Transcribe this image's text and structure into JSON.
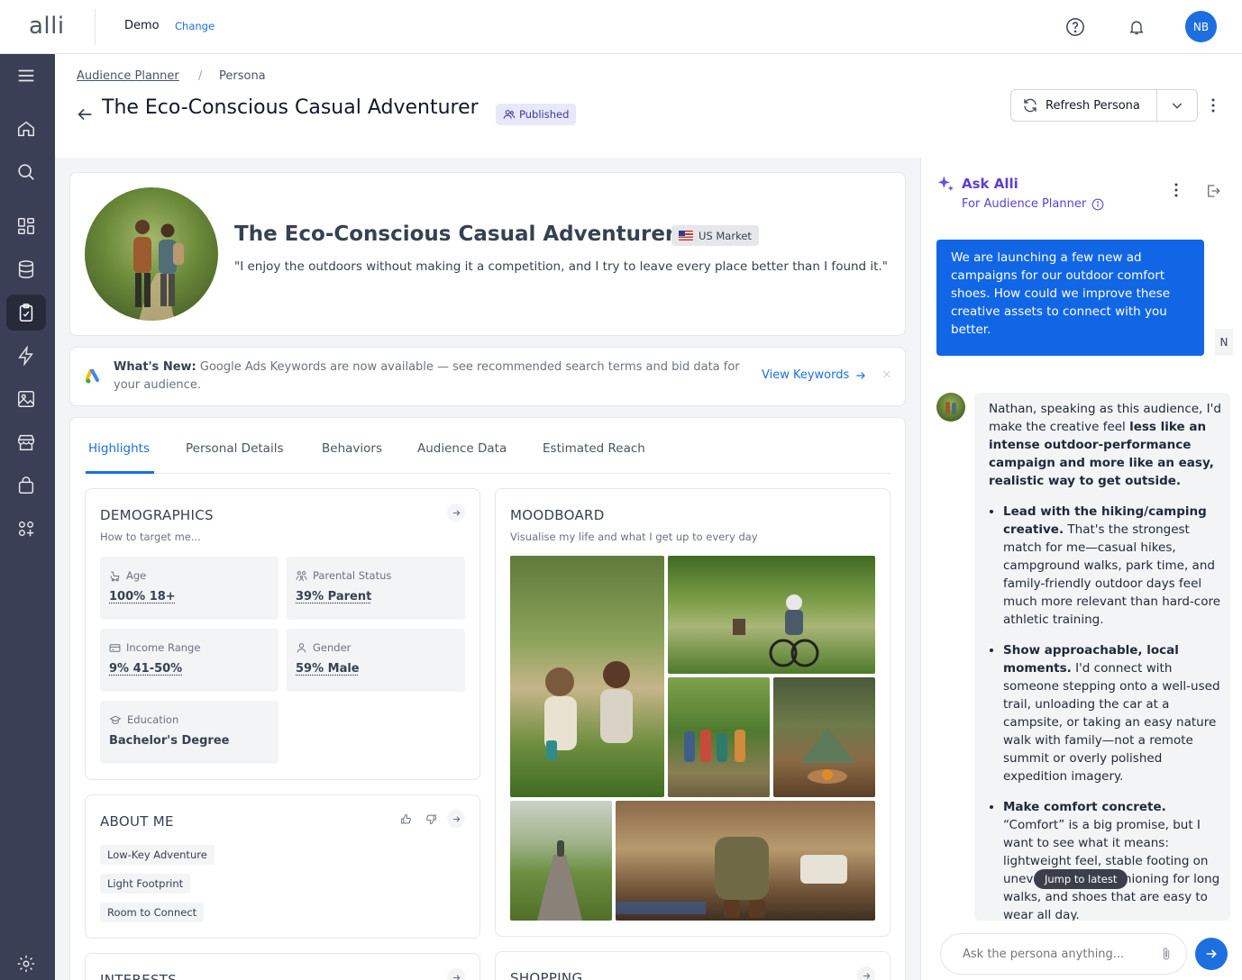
{
  "topbar": {
    "logo": "alli",
    "org_name": "Demo",
    "org_change": "Change",
    "help_icon": "help-circle-icon",
    "bell_icon": "bell-icon",
    "user_initials": "NB",
    "accent": "#1d6fe0"
  },
  "rail": {
    "items": [
      "menu-icon",
      "home-icon",
      "search-icon",
      "dashboard-icon",
      "database-icon",
      "clipboard-check-icon",
      "lightning-icon",
      "image-icon",
      "store-icon",
      "bag-icon",
      "apps-icon",
      "settings-icon"
    ],
    "active": "clipboard-check-icon",
    "bg": "#3a3f55"
  },
  "header": {
    "breadcrumb_link": "Audience Planner",
    "breadcrumb_sep": "/",
    "breadcrumb_current": "Persona",
    "title": "The Eco-Conscious Casual Adventurer",
    "status_badge": "Published",
    "refresh_label": "Refresh Persona"
  },
  "persona": {
    "name": "The Eco-Conscious Casual Adventurer",
    "market": "US Market",
    "quote": "\"I enjoy the outdoors without making it a competition, and I try to leave every place better than I found it.\""
  },
  "news": {
    "label": "What's New:",
    "text": "Google Ads Keywords are now available — see recommended search terms and bid data for your audience.",
    "link": "View Keywords",
    "close": "×"
  },
  "tabs": [
    "Highlights",
    "Personal Details",
    "Behaviors",
    "Audience Data",
    "Estimated Reach"
  ],
  "demographics": {
    "title": "DEMOGRAPHICS",
    "desc": "How to target me...",
    "stats": [
      {
        "label": "Age",
        "value": "100% 18+",
        "icon": "stroller-icon"
      },
      {
        "label": "Parental Status",
        "value": "39% Parent",
        "icon": "family-icon"
      },
      {
        "label": "Income Range",
        "value": "9% 41-50%",
        "icon": "credit-card-icon"
      },
      {
        "label": "Gender",
        "value": "59% Male",
        "icon": "person-icon"
      },
      {
        "label": "Education",
        "value": "Bachelor's Degree",
        "icon": "graduation-cap-icon"
      }
    ]
  },
  "about": {
    "title": "ABOUT ME",
    "chips": [
      "Low-Key Adventure",
      "Light Footprint",
      "Room to Connect"
    ]
  },
  "interests": {
    "title": "INTERESTS"
  },
  "moodboard": {
    "title": "MOODBOARD",
    "desc": "Visualise my life and what I get up to every day"
  },
  "shopping": {
    "title": "SHOPPING"
  },
  "chat": {
    "title": "Ask Alli",
    "subtitle": "For Audience Planner",
    "user_message": "We are launching a few new ad campaigns for our outdoor comfort shoes. How could we improve these creative assets to connect with you better.",
    "user_initial": "N",
    "reply_intro_a": "Nathan, speaking as this audience, I'd make the creative feel ",
    "reply_intro_b": "less like an intense outdoor-performance campaign and more like an easy, realistic way to get outside.",
    "bullets": [
      {
        "bold": "Lead with the hiking/camping creative.",
        "text": " That's the strongest match for me—casual hikes, campground walks, park time, and family-friendly outdoor days feel much more relevant than hard-core athletic training."
      },
      {
        "bold": "Show approachable, local moments.",
        "text": " I'd connect with someone stepping onto a well-used trail, unloading the car at a campsite, or taking an easy nature walk with family—not a remote summit or overly polished expedition imagery."
      },
      {
        "bold": "Make comfort concrete.",
        "text": " “Comfort” is a big promise, but I want to see what it means: lightweight feel, stable footing on uneven ground, cushioning for long walks, and shoes that are easy to wear all day."
      }
    ],
    "jump_label": "Jump to latest",
    "input_placeholder": "Ask the persona anything..."
  }
}
